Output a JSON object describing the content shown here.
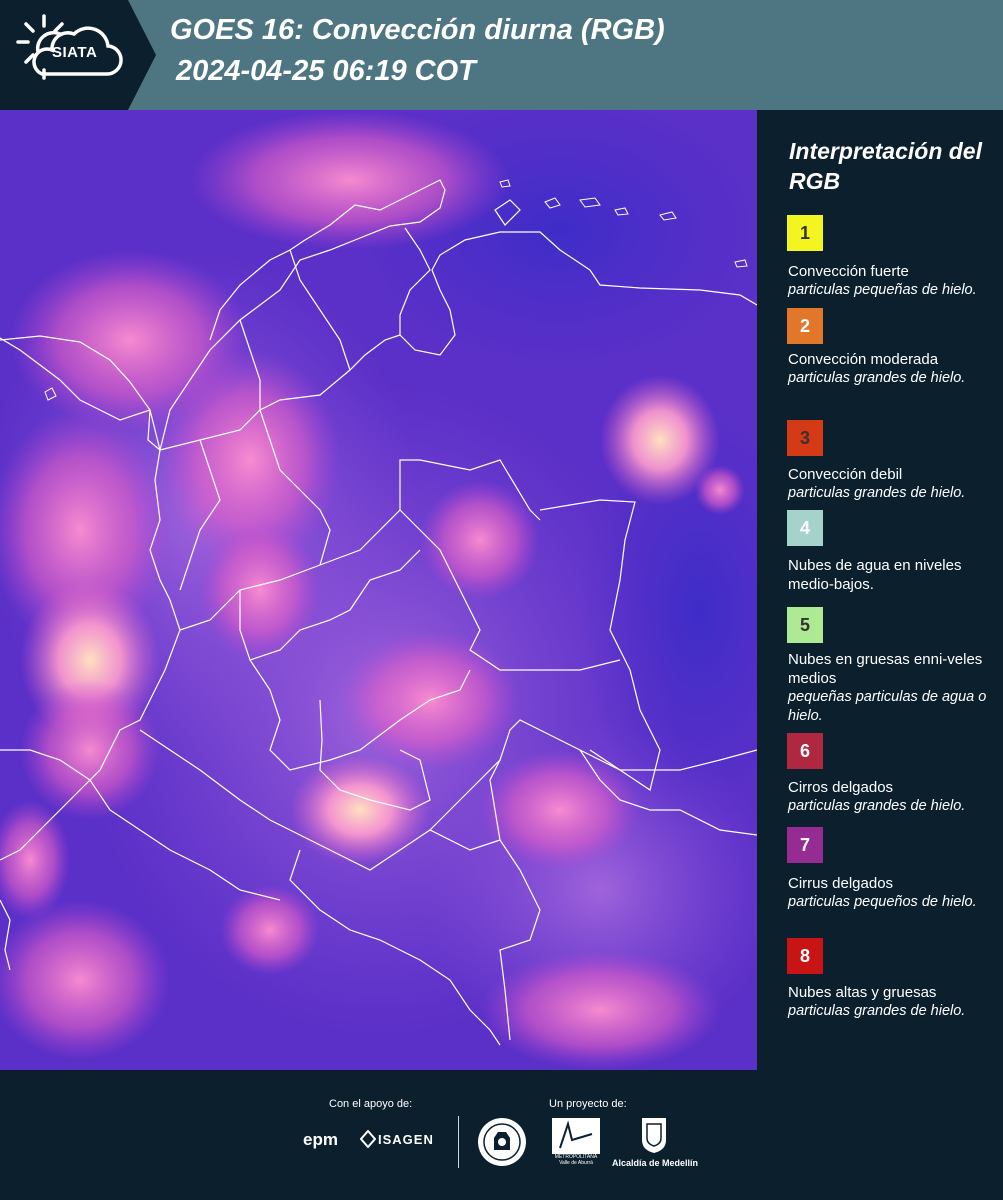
{
  "header": {
    "logo_text": "SIATA",
    "title_line1": "GOES 16: Convección diurna (RGB)",
    "title_line2": "2024-04-25 06:19 COT"
  },
  "legend": {
    "title": "Interpretación del RGB",
    "items": [
      {
        "num": "1",
        "color": "#f2f51f",
        "label": "Convección fuerte",
        "sub": "particulas pequeñas de hielo."
      },
      {
        "num": "2",
        "color": "#e2772a",
        "label": "Convección moderada",
        "sub": "particulas grandes de hielo."
      },
      {
        "num": "3",
        "color": "#d43a16",
        "label": "Convección debil",
        "sub": "particulas grandes de hielo."
      },
      {
        "num": "4",
        "color": "#a6d2cc",
        "label": "Nubes de agua en niveles medio-bajos.",
        "sub": ""
      },
      {
        "num": "5",
        "color": "#aee994",
        "label": "Nubes en gruesas enni-veles medios",
        "sub": "pequeñas particulas de agua o hielo."
      },
      {
        "num": "6",
        "color": "#b0283f",
        "label": "Cirros delgados",
        "sub": "particulas grandes de hielo."
      },
      {
        "num": "7",
        "color": "#962c93",
        "label": "Cirrus delgados",
        "sub": "particulas pequeños de hielo."
      },
      {
        "num": "8",
        "color": "#c81414",
        "label": "Nubes altas y gruesas",
        "sub": "particulas grandes de hielo."
      }
    ]
  },
  "footer": {
    "support_label": "Con el apoyo de:",
    "project_label": "Un proyecto de:",
    "epm": "epm",
    "isagen": "ISAGEN",
    "amva_name": "METROPOLITANA Valle de Aburrá",
    "amva_script": "Área",
    "alcaldia": "Alcaldía de Medellín"
  }
}
